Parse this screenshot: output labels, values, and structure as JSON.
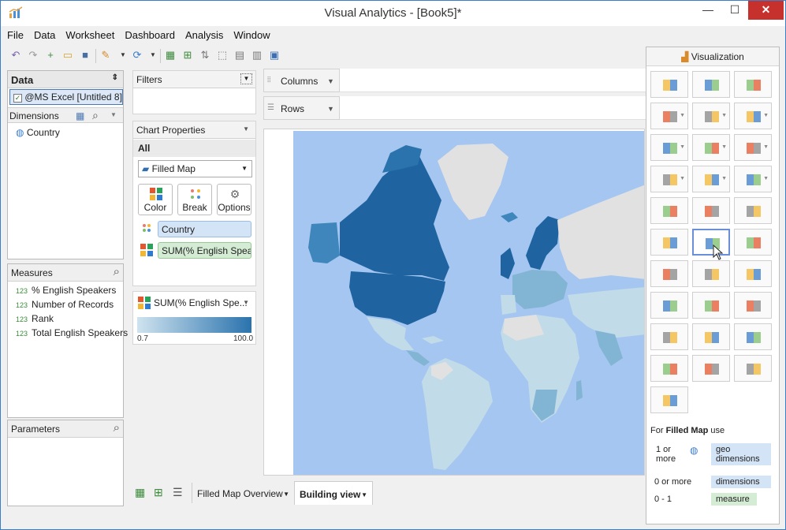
{
  "window": {
    "title": "Visual Analytics - [Book5]*",
    "min_glyph": "—",
    "max_glyph": "☐",
    "close_glyph": "✕"
  },
  "menu": [
    "File",
    "Data",
    "Worksheet",
    "Dashboard",
    "Analysis",
    "Window"
  ],
  "data_panel": {
    "header": "Data",
    "source": "@MS Excel [Untitled 8]",
    "dimensions_label": "Dimensions",
    "dimensions": [
      "Country"
    ],
    "measures_label": "Measures",
    "measure_prefix": "123",
    "measures": [
      "% English Speakers",
      "Number of Records",
      "Rank",
      "Total English Speakers"
    ],
    "parameters_label": "Parameters"
  },
  "filters": {
    "label": "Filters"
  },
  "chart_properties": {
    "label": "Chart Properties",
    "all_label": "All",
    "chart_type": "Filled Map",
    "buttons": [
      "Color",
      "Break",
      "Options"
    ],
    "pills": [
      "Country",
      "SUM(% English Spea..."
    ]
  },
  "legend": {
    "title": "SUM(% English Spe...",
    "min": "0.7",
    "max": "100.0",
    "color_low": "#cfe3ef",
    "color_high": "#2a73ad"
  },
  "shelves": {
    "columns": "Columns",
    "rows": "Rows"
  },
  "tabs": [
    "Filled Map Overview",
    "Building view"
  ],
  "visualization": {
    "header": "Visualization",
    "for_text": "For",
    "chart_name": "Filled Map",
    "use_text": "use",
    "requirements": [
      {
        "count": "1 or more",
        "field": "geo dimensions"
      },
      {
        "count": "0 or more",
        "field": "dimensions"
      },
      {
        "count": "0 - 1",
        "field": "measure"
      }
    ]
  },
  "colors": {
    "accent": "#3a7dc9",
    "ocean": "#a5c6f0",
    "land_unknown": "#e1e1e1",
    "land_light": "#c2dbe8",
    "land_mid": "#82b5d3",
    "land_dark": "#3e86bb",
    "land_darkest": "#1f64a0"
  }
}
